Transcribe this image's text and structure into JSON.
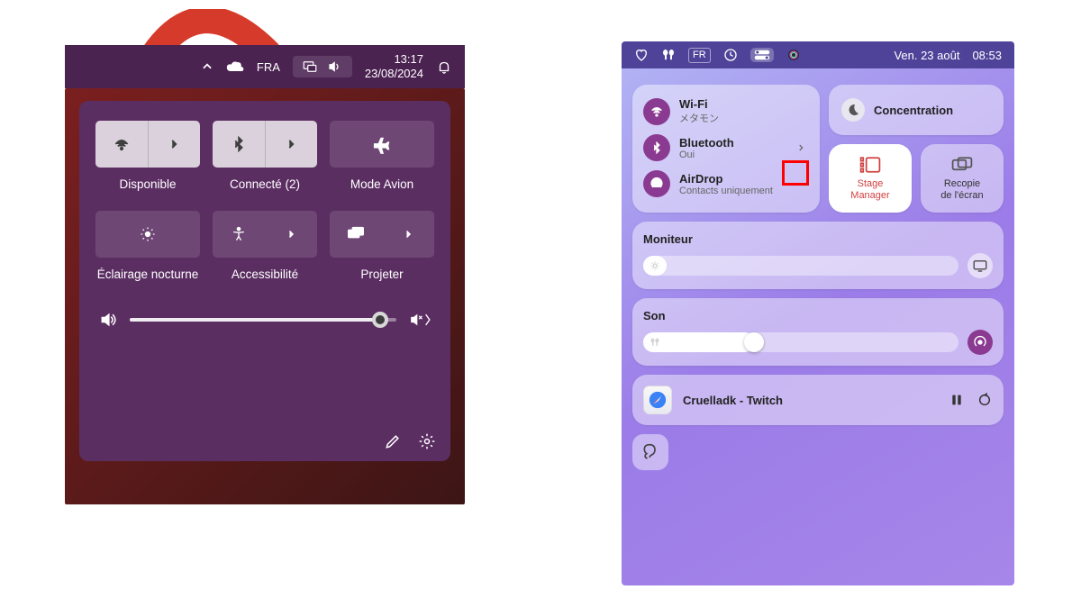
{
  "windows": {
    "tiles": [
      {
        "label": "Disponible",
        "active": true,
        "split": true
      },
      {
        "label": "Connecté (2)",
        "active": true,
        "split": true
      },
      {
        "label": "Mode Avion",
        "active": false,
        "split": false
      },
      {
        "label": "Éclairage nocturne",
        "active": false,
        "split": false
      },
      {
        "label": "Accessibilité",
        "active": false,
        "split": true
      },
      {
        "label": "Projeter",
        "active": false,
        "split": true
      }
    ],
    "volume_percent": 94,
    "taskbar": {
      "language": "FRA",
      "time": "13:17",
      "date": "23/08/2024"
    }
  },
  "mac": {
    "menubar": {
      "lang": "FR",
      "date": "Ven. 23 août",
      "time": "08:53"
    },
    "connectivity": {
      "wifi": {
        "title": "Wi-Fi",
        "sub": "メタモン"
      },
      "bluetooth": {
        "title": "Bluetooth",
        "sub": "Oui"
      },
      "airdrop": {
        "title": "AirDrop",
        "sub": "Contacts uniquement"
      }
    },
    "focus_label": "Concentration",
    "stage": {
      "title": "Stage",
      "sub": "Manager"
    },
    "mirror": {
      "title": "Recopie",
      "sub": "de l'écran"
    },
    "monitor": {
      "label": "Moniteur",
      "percent": 4
    },
    "sound": {
      "label": "Son",
      "percent": 35
    },
    "media": {
      "title": "Cruelladk - Twitch"
    }
  },
  "colors": {
    "win_panel": "#5b2e62",
    "win_taskbar": "#4b2351",
    "mac_accent": "#8b3a91",
    "arrow": "#d63a2a"
  }
}
